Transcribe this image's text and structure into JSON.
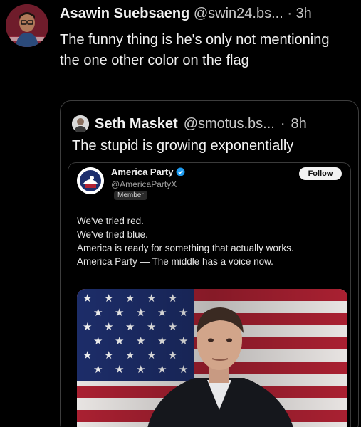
{
  "post": {
    "author_name": "Asawin Suebsaeng",
    "handle": "@swin24.bs...",
    "separator": "·",
    "time": "3h",
    "text": "The funny thing is he's only not mentioning the one other color on the flag"
  },
  "quote": {
    "author_name": "Seth Masket",
    "handle": "@smotus.bs...",
    "separator": "·",
    "time": "8h",
    "text": "The stupid is growing exponentially"
  },
  "embed": {
    "author_name": "America Party",
    "handle": "@AmericaPartyX",
    "badge": "Member",
    "follow_label": "Follow",
    "lines": [
      "We've tried red.",
      "We've tried blue.",
      "America is ready for something that actually works.",
      "America Party — The middle has a voice now."
    ]
  },
  "icons": {
    "verified": "verified-badge-icon"
  },
  "colors": {
    "background": "#000000",
    "text": "#f2f2f2",
    "muted": "#c8c8c8",
    "verified": "#1d9bf0",
    "flag_red": "#b22234",
    "flag_blue": "#1e2f6e"
  }
}
